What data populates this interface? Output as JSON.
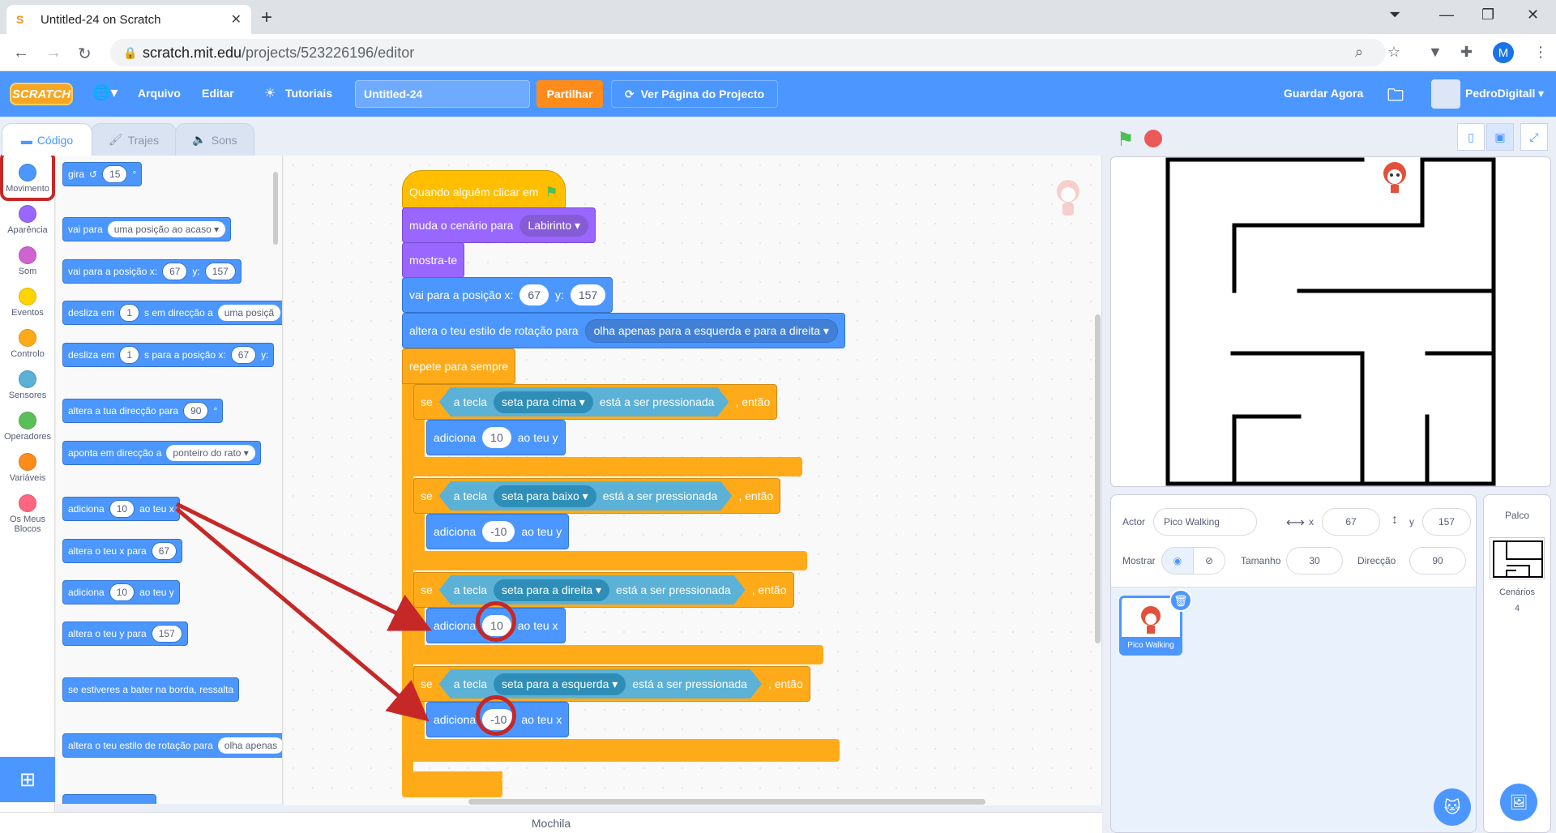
{
  "browser": {
    "tab_title": "Untitled-24 on Scratch",
    "url_host": "scratch.mit.edu",
    "url_path": "/projects/523226196/editor",
    "profile_initial": "M"
  },
  "menubar": {
    "logo": "SCRATCH",
    "file": "Arquivo",
    "edit": "Editar",
    "tutorials": "Tutoriais",
    "project_title": "Untitled-24",
    "share": "Partilhar",
    "see_project": "Ver Página do Projecto",
    "save_now": "Guardar Agora",
    "username": "PedroDigitall"
  },
  "tabs": {
    "code": "Código",
    "costumes": "Trajes",
    "sounds": "Sons"
  },
  "categories": [
    {
      "label": "Movimento",
      "color": "#4c97ff"
    },
    {
      "label": "Aparência",
      "color": "#9966ff"
    },
    {
      "label": "Som",
      "color": "#cf63cf"
    },
    {
      "label": "Eventos",
      "color": "#ffd500"
    },
    {
      "label": "Controlo",
      "color": "#ffab19"
    },
    {
      "label": "Sensores",
      "color": "#5cb1d6"
    },
    {
      "label": "Operadores",
      "color": "#59c059"
    },
    {
      "label": "Variáveis",
      "color": "#ff8c1a"
    },
    {
      "label": "Os Meus Blocos",
      "color": "#ff6680"
    }
  ],
  "palette": {
    "turn": "gira",
    "turn_val": "15",
    "deg": "°",
    "goto": "vai para",
    "goto_opt": "uma posição ao acaso",
    "gotoxy": "vai para a posição x:",
    "x": "67",
    "y_label": "y:",
    "y": "157",
    "glide1": "desliza em",
    "glide_val": "1",
    "glide1_mid": "s em direcção a",
    "glide1_opt": "uma posiçã",
    "glide2_mid": "s para a posição x:",
    "point": "altera a tua direcção para",
    "point_val": "90",
    "pointto": "aponta em direcção a",
    "pointto_opt": "ponteiro do rato",
    "changex": "adiciona",
    "changex_val": "10",
    "changex_end": "ao teu x",
    "setx": "altera o teu x para",
    "setx_val": "67",
    "changey": "adiciona",
    "changey_val": "10",
    "changey_end": "ao teu y",
    "sety": "altera o teu y para",
    "sety_val": "157",
    "bounce": "se estiveres a bater na borda, ressalta",
    "rotstyle": "altera o teu estilo de rotação para",
    "rotstyle_opt": "olha apenas"
  },
  "script": {
    "hat": "Quando alguém clicar em",
    "backdrop": "muda o cenário para",
    "backdrop_opt": "Labirinto",
    "show": "mostra-te",
    "gotoxy": "vai para a posição x:",
    "x": "67",
    "y_label": "y:",
    "y": "157",
    "rotstyle": "altera o teu estilo de rotação para",
    "rotstyle_opt": "olha apenas para a esquerda e para a direita",
    "forever": "repete para sempre",
    "if": "se",
    "then": ", então",
    "key": "a tecla",
    "pressed": "está a ser pressionada",
    "k_up": "seta para cima",
    "k_down": "seta para baixo",
    "k_right": "seta para a direita",
    "k_left": "seta para a esquerda",
    "change": "adiciona",
    "v_up": "10",
    "v_down": "-10",
    "v_right": "10",
    "v_left": "-10",
    "end_y": "ao teu y",
    "end_x": "ao teu x"
  },
  "sprite_info": {
    "actor_label": "Actor",
    "actor": "Pico Walking",
    "x_label": "x",
    "x": "67",
    "y_label": "y",
    "y": "157",
    "show_label": "Mostrar",
    "size_label": "Tamanho",
    "size": "30",
    "dir_label": "Direcção",
    "dir": "90"
  },
  "sprite_name": "Pico Walking",
  "stage_panel": {
    "title": "Palco",
    "backdrops_label": "Cenários",
    "backdrops_count": "4"
  },
  "backpack": "Mochila",
  "colors": {
    "accent": "#4c97ff",
    "annotation": "#c62828"
  }
}
